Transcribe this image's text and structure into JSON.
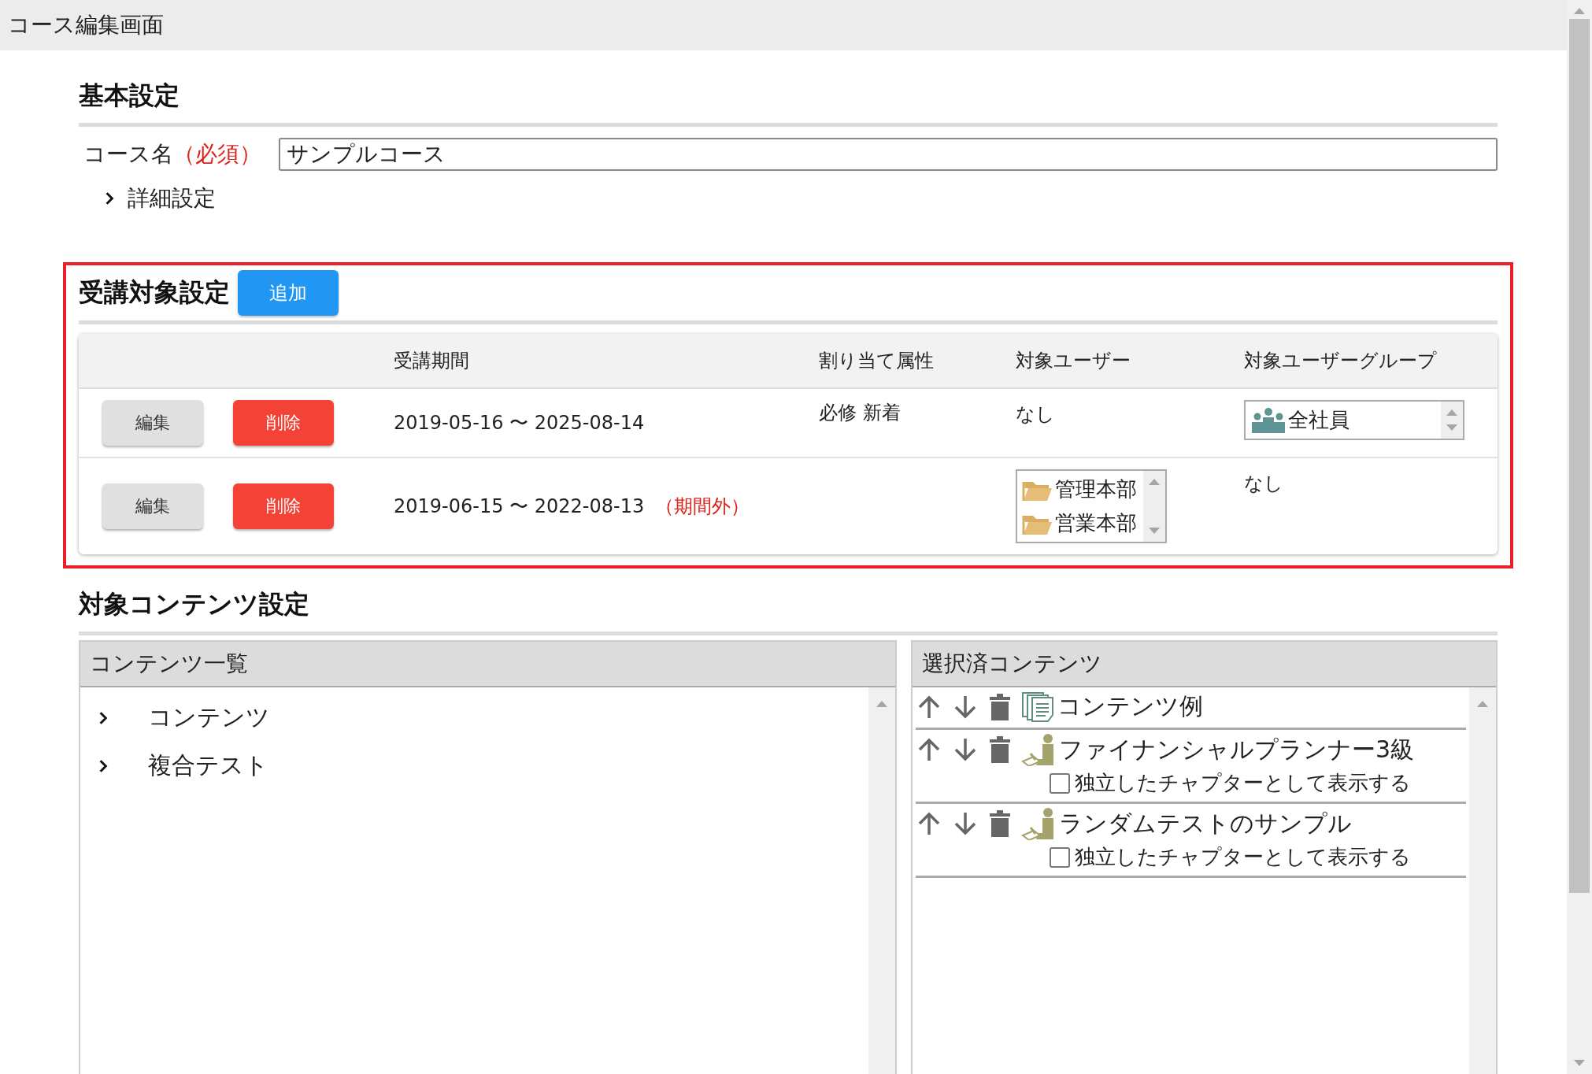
{
  "title_bar": {
    "title": "コース編集画面"
  },
  "basic_settings": {
    "heading": "基本設定",
    "course_name": {
      "label": "コース名",
      "required": "（必須）",
      "value": "サンプルコース"
    },
    "details": {
      "label": "詳細設定",
      "expanded": false
    }
  },
  "target_settings": {
    "heading": "受講対象設定",
    "add_button": "追加",
    "columns": [
      "受講期間",
      "割り当て属性",
      "対象ユーザー",
      "対象ユーザーグループ"
    ],
    "rows": [
      {
        "edit": "編集",
        "delete": "削除",
        "period": "2019-05-16 〜 2025-08-14",
        "attributes": "必修 新着",
        "users": {
          "kind": "text",
          "text": "なし"
        },
        "groups": {
          "kind": "list",
          "items": [
            {
              "kind": "group",
              "label": "全社員"
            }
          ]
        }
      },
      {
        "edit": "編集",
        "delete": "削除",
        "period": "2019-06-15 〜 2022-08-13",
        "period_note": "（期間外）",
        "users": {
          "kind": "list",
          "items": [
            {
              "kind": "folder",
              "label": "管理本部"
            },
            {
              "kind": "folder",
              "label": "営業本部"
            }
          ]
        },
        "groups": {
          "kind": "text",
          "text": "なし"
        }
      }
    ]
  },
  "content_settings": {
    "heading": "対象コンテンツ設定",
    "content_list": {
      "title": "コンテンツ一覧",
      "items": [
        {
          "label": "コンテンツ",
          "expanded": false
        },
        {
          "label": "複合テスト",
          "expanded": false
        }
      ]
    },
    "selected_content": {
      "title": "選択済コンテンツ",
      "items": [
        {
          "kind": "document",
          "label": "コンテンツ例"
        },
        {
          "kind": "test",
          "label": "ファイナンシャルプランナー3級",
          "chapter_option": {
            "label": "独立したチャプターとして表示する",
            "checked": false
          }
        },
        {
          "kind": "test",
          "label": "ランダムテストのサンプル",
          "chapter_option": {
            "label": "独立したチャプターとして表示する",
            "checked": false
          }
        }
      ]
    }
  }
}
